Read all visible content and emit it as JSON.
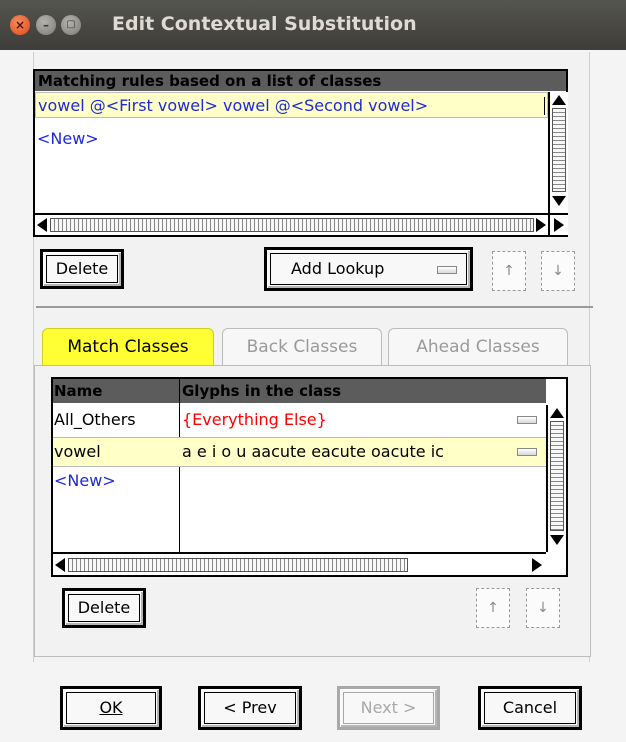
{
  "window": {
    "title": "Edit Contextual Substitution",
    "controls": {
      "close": "×",
      "minimize": "–",
      "maximize": "▢"
    }
  },
  "rules": {
    "header": "Matching rules based on a list of classes",
    "items": [
      {
        "text": "vowel  @<First vowel> vowel @<Second vowel>",
        "selected": true
      },
      {
        "text": "<New>",
        "selected": false
      }
    ],
    "delete_label": "Delete",
    "add_lookup_label": "Add Lookup",
    "up_label": "↑",
    "down_label": "↓"
  },
  "tabs": [
    {
      "label": "Match Classes",
      "active": true
    },
    {
      "label": "Back Classes",
      "active": false
    },
    {
      "label": "Ahead Classes",
      "active": false
    }
  ],
  "classes": {
    "columns": [
      "Name",
      "Glyphs in the class"
    ],
    "rows": [
      {
        "name": "All_Others",
        "glyphs": "{Everything Else}"
      },
      {
        "name": "vowel",
        "glyphs": "a e i o u aacute eacute oacute ic"
      },
      {
        "name": "<New>",
        "glyphs": ""
      }
    ],
    "delete_label": "Delete",
    "up_label": "↑",
    "down_label": "↓"
  },
  "footer": {
    "ok_label": "OK",
    "prev_label": "< Prev",
    "next_label": "Next >",
    "cancel_label": "Cancel"
  },
  "colors": {
    "selected_row": "#ffffc8",
    "active_tab": "#ffff33",
    "link_blue": "#1f2bd6",
    "special_red": "#ff0000"
  }
}
